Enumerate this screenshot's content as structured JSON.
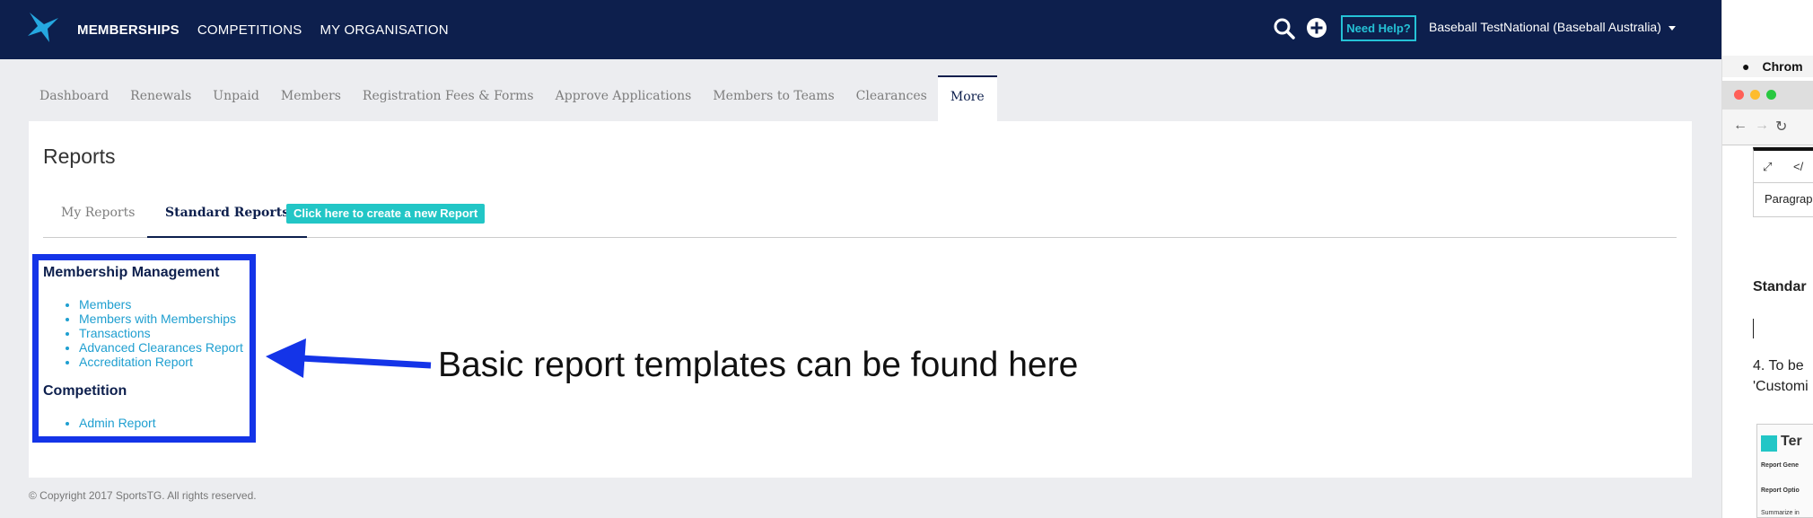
{
  "topbar": {
    "nav": [
      "MEMBERSHIPS",
      "COMPETITIONS",
      "MY ORGANISATION"
    ],
    "help_label": "Need Help?",
    "org_name": "Baseball TestNational (Baseball Australia)"
  },
  "subnav": {
    "tabs": [
      "Dashboard",
      "Renewals",
      "Unpaid",
      "Members",
      "Registration Fees & Forms",
      "Approve Applications",
      "Members to Teams",
      "Clearances",
      "More"
    ]
  },
  "main": {
    "title": "Reports",
    "report_tabs": [
      "My Reports",
      "Standard Reports"
    ],
    "create_label": "Click here to create a new Report",
    "sections": [
      {
        "title": "Membership Management",
        "items": [
          "Members",
          "Members with Memberships",
          "Transactions",
          "Advanced Clearances Report",
          "Accreditation Report"
        ]
      },
      {
        "title": "Competition",
        "items": [
          "Admin Report"
        ]
      }
    ]
  },
  "annotation": {
    "text": "Basic report templates can be found here",
    "color": "#1434e8"
  },
  "footer": {
    "copyright": "© Copyright 2017 SportsTG. All rights reserved."
  },
  "side_window": {
    "menubar_app": "Chrom",
    "format_label": "Paragrap",
    "heading_fragment": "Standar",
    "step_line1": "4. To be",
    "step_line2": "'Customi",
    "box_title": "Ter",
    "box_line1": "Report Gene",
    "box_line2": "Report Optio",
    "box_line3": "Summarize in"
  },
  "colors": {
    "navbar": "#0d1f4d",
    "accent": "#22c6c6",
    "link": "#1f9fd0"
  }
}
